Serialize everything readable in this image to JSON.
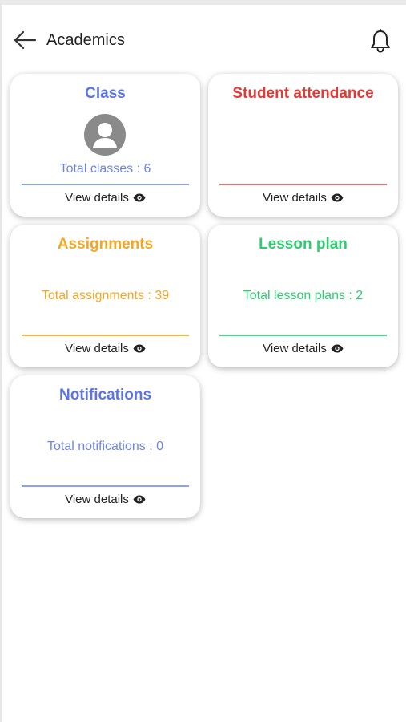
{
  "header": {
    "title": "Academics",
    "back_icon": "arrow-left-icon",
    "notification_icon": "bell-icon"
  },
  "colors": {
    "class": "#5b73e8",
    "attendance": "#e53935",
    "assignments": "#f5a623",
    "lesson_plan": "#2ecc71",
    "notifications": "#5b73e8"
  },
  "cards": {
    "class": {
      "title": "Class",
      "stat": "Total classes : 6",
      "action": "View details"
    },
    "attendance": {
      "title": "Student attendance",
      "action": "View details"
    },
    "assignments": {
      "title": "Assignments",
      "stat": "Total assignments : 39",
      "action": "View details"
    },
    "lesson_plan": {
      "title": "Lesson plan",
      "stat": "Total lesson plans : 2",
      "action": "View details"
    },
    "notifications": {
      "title": "Notifications",
      "stat": "Total notifications : 0",
      "action": "View details"
    }
  }
}
